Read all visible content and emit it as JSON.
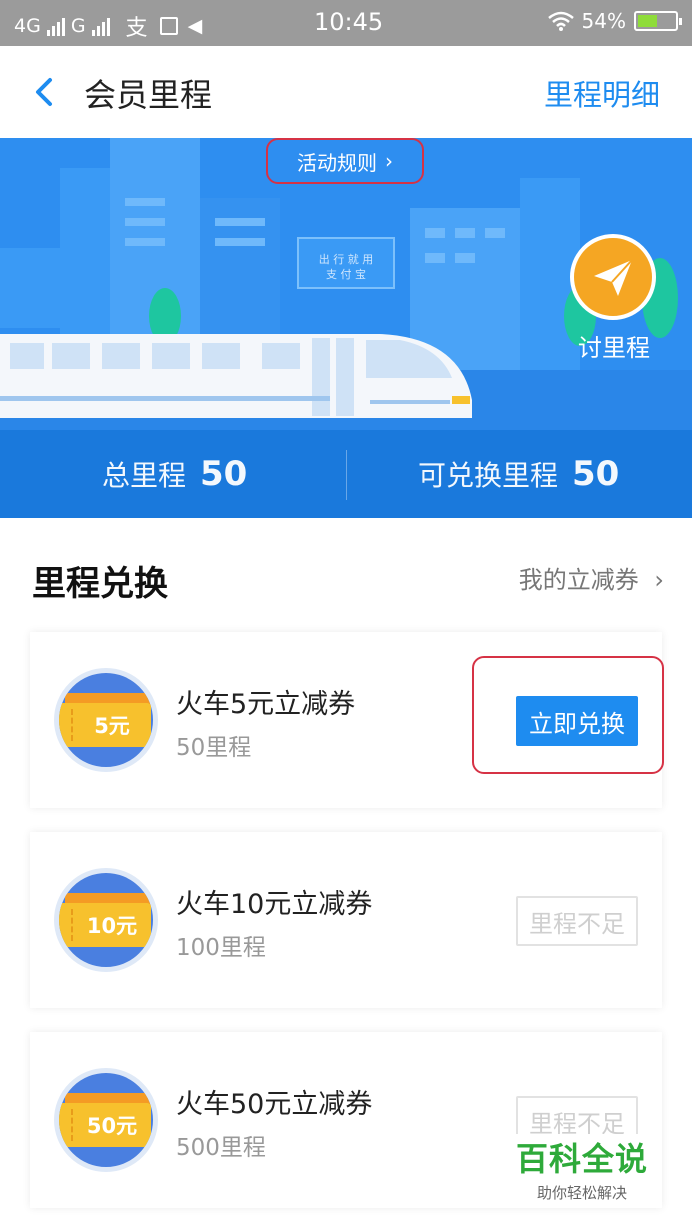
{
  "status_bar": {
    "carrier_left": "4G",
    "carrier_mid": "G",
    "time": "10:45",
    "battery_pct": "54%",
    "battery_level": 0.54
  },
  "nav": {
    "title": "会员里程",
    "right_link": "里程明细"
  },
  "banner": {
    "rules_label": "活动规则",
    "sign_line1": "出 行 就 用",
    "sign_line2": "支 付 宝",
    "tao_label": "讨里程"
  },
  "stats": {
    "total_label": "总里程",
    "total_value": "50",
    "redeemable_label": "可兑换里程",
    "redeemable_value": "50"
  },
  "section": {
    "title": "里程兑换",
    "link": "我的立减券"
  },
  "coupons": [
    {
      "badge": "5元",
      "title": "火车5元立减券",
      "cost": "50里程",
      "button": "立即兑换",
      "enabled": true
    },
    {
      "badge": "10元",
      "title": "火车10元立减券",
      "cost": "100里程",
      "button": "里程不足",
      "enabled": false
    },
    {
      "badge": "50元",
      "title": "火车50元立减券",
      "cost": "500里程",
      "button": "里程不足",
      "enabled": false
    }
  ],
  "watermark": {
    "main": "百科全说",
    "sub": "助你轻松解决"
  },
  "colors": {
    "accent": "#1e8cf0",
    "banner_blue": "#2e8ef0",
    "stats_blue": "#1a79dc",
    "highlight_red": "#d63245",
    "ticket_yellow": "#f7c12d",
    "watermark_green": "#2eaa3a"
  }
}
